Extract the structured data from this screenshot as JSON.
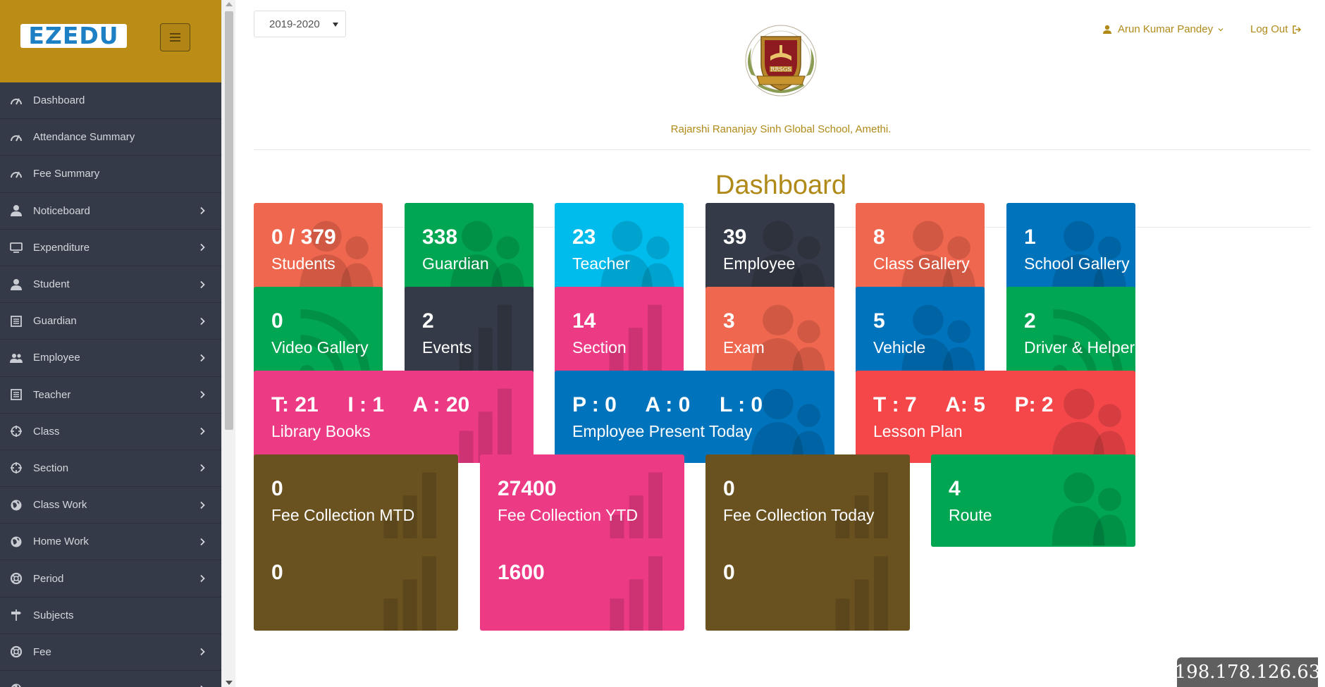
{
  "sidebar": {
    "brand": "EZEDU",
    "items": [
      {
        "label": "Dashboard",
        "icon": "speedometer-icon",
        "chevron": false
      },
      {
        "label": "Attendance Summary",
        "icon": "speedometer-icon",
        "chevron": false
      },
      {
        "label": "Fee Summary",
        "icon": "speedometer-icon",
        "chevron": false
      },
      {
        "label": "Noticeboard",
        "icon": "user-icon",
        "chevron": true
      },
      {
        "label": "Expenditure",
        "icon": "monitor-icon",
        "chevron": true
      },
      {
        "label": "Student",
        "icon": "user-icon",
        "chevron": true
      },
      {
        "label": "Guardian",
        "icon": "list-icon",
        "chevron": true
      },
      {
        "label": "Employee",
        "icon": "users-icon",
        "chevron": true
      },
      {
        "label": "Teacher",
        "icon": "list-icon",
        "chevron": true
      },
      {
        "label": "Class",
        "icon": "crosshair-icon",
        "chevron": true
      },
      {
        "label": "Section",
        "icon": "crosshair-icon",
        "chevron": true
      },
      {
        "label": "Class Work",
        "icon": "globe-icon",
        "chevron": true
      },
      {
        "label": "Home Work",
        "icon": "globe-icon",
        "chevron": true
      },
      {
        "label": "Period",
        "icon": "lifebuoy-icon",
        "chevron": true
      },
      {
        "label": "Subjects",
        "icon": "signpost-icon",
        "chevron": false
      },
      {
        "label": "Fee",
        "icon": "lifebuoy-icon",
        "chevron": true
      },
      {
        "label": "",
        "icon": "globe-icon",
        "chevron": true
      }
    ]
  },
  "header": {
    "session_year": "2019-2020",
    "school_name": "Rajarshi Rananjay Sinh Global School, Amethi.",
    "crest_text": "RRSGS",
    "user_name": "Arun Kumar Pandey",
    "logout_label": "Log Out"
  },
  "page_title": "Dashboard",
  "colors": {
    "brand": "#bb8d17",
    "sidebar": "#343a47",
    "accent_text": "#b08a19"
  },
  "tiles": [
    {
      "value": "0 / 379",
      "label": "Students",
      "color": "#f0674f",
      "icon": "people-icon"
    },
    {
      "value": "338",
      "label": "Guardian",
      "color": "#00a651",
      "icon": "people-icon"
    },
    {
      "value": "23",
      "label": "Teacher",
      "color": "#00bcec",
      "icon": "people-icon"
    },
    {
      "value": "39",
      "label": "Employee",
      "color": "#343a47",
      "icon": "people-icon"
    },
    {
      "value": "8",
      "label": "Class Gallery",
      "color": "#f0674f",
      "icon": "people-icon"
    },
    {
      "value": "1",
      "label": "School Gallery",
      "color": "#0073bd",
      "icon": "people-icon"
    },
    {
      "value": "0",
      "label": "Video Gallery",
      "color": "#00a651",
      "icon": "rss-icon"
    },
    {
      "value": "2",
      "label": "Events",
      "color": "#343a47",
      "icon": "bar-chart-icon"
    },
    {
      "value": "14",
      "label": "Section",
      "color": "#ec3a84",
      "icon": "bar-chart-icon"
    },
    {
      "value": "3",
      "label": "Exam",
      "color": "#f0674f",
      "icon": "people-icon"
    },
    {
      "value": "5",
      "label": "Vehicle",
      "color": "#0073bd",
      "icon": "people-icon"
    },
    {
      "value": "2",
      "label": "Driver & Helper",
      "color": "#00a651",
      "icon": "rss-icon"
    },
    {
      "value": "T: 21     I : 1     A : 20",
      "label": "Library Books",
      "color": "#ec3a84",
      "icon": "bar-chart-icon"
    },
    {
      "value": "P : 0     A : 0     L : 0",
      "label": "Employee Present Today",
      "color": "#0073bd",
      "icon": "people-icon"
    },
    {
      "value": "T : 7     A: 5     P: 2",
      "label": "Lesson Plan",
      "color": "#f5474a",
      "icon": "people-icon"
    },
    {
      "value": "0",
      "label": "Fee Collection MTD",
      "color": "#6a5120",
      "icon": "bar-chart-icon"
    },
    {
      "value": "27400",
      "label": "Fee Collection YTD",
      "color": "#ec3a84",
      "icon": "bar-chart-icon"
    },
    {
      "value": "0",
      "label": "Fee Collection Today",
      "color": "#6a5120",
      "icon": "bar-chart-icon"
    },
    {
      "value": "4",
      "label": "Route",
      "color": "#00a651",
      "icon": "people-icon"
    },
    {
      "value": "0",
      "label": "",
      "color": "#6a5120",
      "icon": "bar-chart-icon"
    },
    {
      "value": "1600",
      "label": "",
      "color": "#ec3a84",
      "icon": "bar-chart-icon"
    },
    {
      "value": "0",
      "label": "",
      "color": "#6a5120",
      "icon": "bar-chart-icon"
    }
  ],
  "watermark": "198.178.126.63"
}
